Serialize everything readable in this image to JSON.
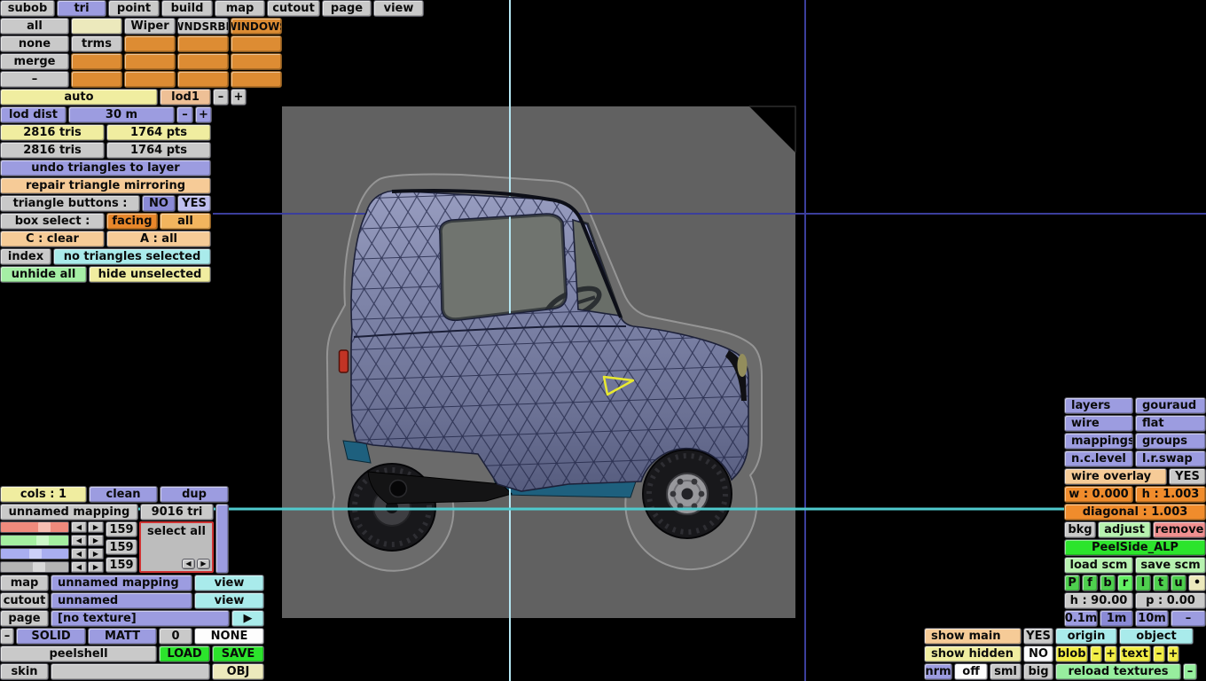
{
  "menu": {
    "items": [
      "subob",
      "tri",
      "point",
      "build",
      "map",
      "cutout",
      "page",
      "view"
    ],
    "active": "tri"
  },
  "tri_panel": {
    "all": "all",
    "blank": "",
    "wiper": "Wiper",
    "wndsrbr": "WNDSRBR",
    "windows": "WINDOWS",
    "none": "none",
    "trms": "trms",
    "merge": "merge",
    "minus": "–",
    "auto": "auto",
    "lod1": "lod1",
    "lod_minus": "–",
    "lod_plus": "+",
    "lod_dist_label": "lod dist",
    "lod_dist_value": "30 m",
    "dist_minus": "–",
    "dist_plus": "+",
    "tris_a": "2816 tris",
    "pts_a": "1764 pts",
    "tris_b": "2816 tris",
    "pts_b": "1764 pts",
    "undo": "undo triangles to layer",
    "repair": "repair triangle mirroring",
    "tri_buttons_label": "triangle buttons :",
    "no": "NO",
    "yes": "YES",
    "box_select_label": "box select :",
    "facing": "facing",
    "box_all": "all",
    "c_clear": "C : clear",
    "a_all": "A : all",
    "index": "index",
    "selection_status": "no triangles selected",
    "unhide_all": "unhide all",
    "hide_unselected": "hide unselected"
  },
  "colors_panel": {
    "cols": "cols : 1",
    "clean": "clean",
    "dup": "dup",
    "mapping_name": "unnamed mapping",
    "tri_count": "9016 tri",
    "r": "159",
    "g": "159",
    "b": "159",
    "select_all": "select all",
    "prev": "◀",
    "next": "▶"
  },
  "mapping_panel": {
    "map_label": "map",
    "map_value": "unnamed mapping",
    "map_view": "view",
    "cutout_label": "cutout",
    "cutout_value": "unnamed",
    "cutout_view": "view",
    "page_label": "page",
    "page_value": "[no texture]",
    "page_arrow": "▶",
    "minus": "–",
    "solid": "SOLID",
    "matt": "MATT",
    "zero": "0",
    "none": "NONE",
    "file_name": "peelshell",
    "load": "LOAD",
    "save": "SAVE",
    "skin": "skin",
    "skin_value": "",
    "obj": "OBJ"
  },
  "right_panel": {
    "layers": "layers",
    "gouraud": "gouraud",
    "wire": "wire",
    "flat": "flat",
    "mappings": "mappings",
    "groups": "groups",
    "nc_level": "n.c.level",
    "lr_swap": "l.r.swap",
    "wire_overlay": "wire overlay",
    "wire_overlay_yes": "YES",
    "w": "w : 0.000",
    "h": "h : 1.003",
    "diagonal": "diagonal : 1.003",
    "bkg": "bkg",
    "adjust": "adjust",
    "remove": "remove",
    "scheme_name": "PeelSide_ALP",
    "load_scm": "load scm",
    "save_scm": "save scm",
    "views": [
      "P",
      "f",
      "b",
      "r",
      "l",
      "t",
      "u",
      "•"
    ],
    "active_view": "r",
    "heading": "h : 90.00",
    "pitch": "p : 0.00",
    "grid_01": "0.1m",
    "grid_1": "1m",
    "grid_10": "10m",
    "grid_minus": "–"
  },
  "bottom_right": {
    "show_main": "show main",
    "show_main_yes": "YES",
    "origin": "origin",
    "object": "object",
    "show_hidden": "show hidden",
    "show_hidden_no": "NO",
    "blob": "blob",
    "blob_minus": "–",
    "blob_plus": "+",
    "text": "text",
    "text_minus": "–",
    "text_plus": "+",
    "nrm": "nrm",
    "off": "off",
    "sml": "sml",
    "big": "big",
    "reload": "reload textures",
    "reload_minus": "–"
  },
  "viewport": {
    "selected_triangle_color": "#e9e930",
    "crosshair_blue": "#3b3e9c",
    "crosshair_cyan": "#4fcacd",
    "crosshair_light": "#b5e6f2",
    "background_plane_color": "#616161"
  }
}
